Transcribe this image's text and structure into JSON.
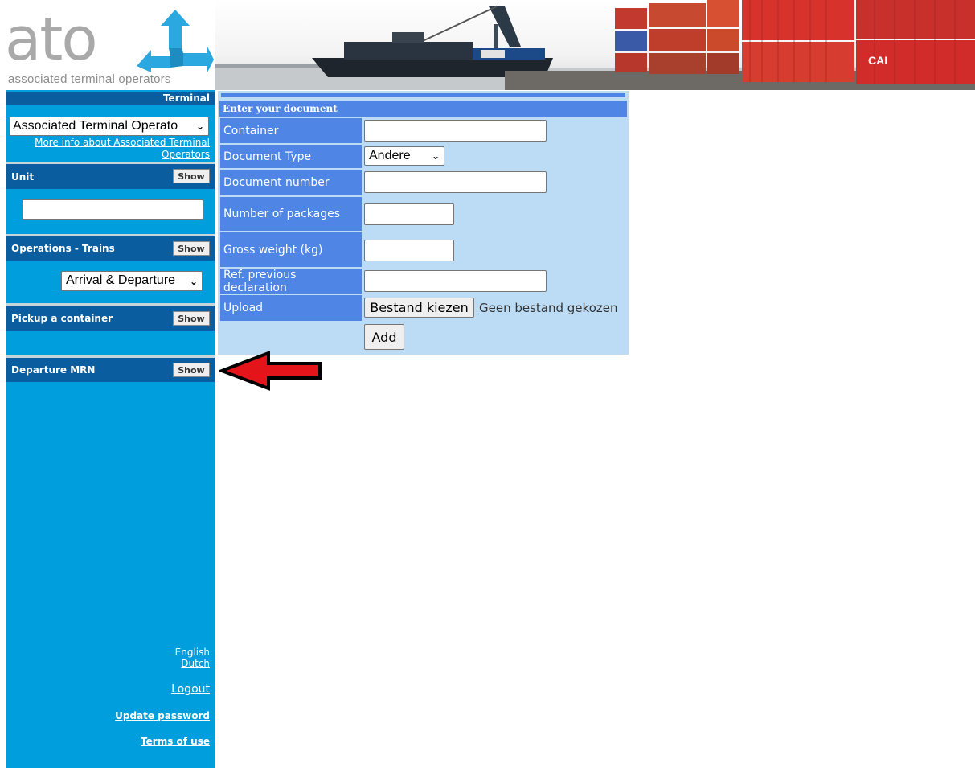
{
  "header": {
    "logo_word": "ato",
    "logo_tagline": "associated terminal operators",
    "banner_container_mark": "CAI"
  },
  "sidebar": {
    "terminal": {
      "title": "Terminal",
      "selected": "Associated Terminal Operato",
      "more_info_line1": "More info about Associated Terminal",
      "more_info_line2": "Operators"
    },
    "unit": {
      "title": "Unit",
      "show_label": "Show",
      "input_value": ""
    },
    "operations_trains": {
      "title": "Operations - Trains",
      "show_label": "Show",
      "selected": "Arrival & Departure"
    },
    "pickup": {
      "title": "Pickup a container",
      "show_label": "Show"
    },
    "departure_mrn": {
      "title": "Departure MRN",
      "show_label": "Show"
    },
    "footer": {
      "lang_current": "English",
      "lang_other": "Dutch",
      "logout": "Logout",
      "update_password": "Update password",
      "terms": "Terms of use"
    }
  },
  "form": {
    "heading": "Enter your document",
    "fields": {
      "container": {
        "label": "Container",
        "value": ""
      },
      "document_type": {
        "label": "Document Type",
        "selected": "Andere"
      },
      "document_number": {
        "label": "Document number",
        "value": ""
      },
      "packages": {
        "label": "Number of packages",
        "value": ""
      },
      "gross_weight": {
        "label": "Gross weight (kg)",
        "value": ""
      },
      "ref_previous": {
        "label": "Ref. previous declaration",
        "value": ""
      },
      "upload": {
        "label": "Upload",
        "button": "Bestand kiezen",
        "status": "Geen bestand gekozen"
      }
    },
    "add_label": "Add"
  },
  "colors": {
    "sidebar_bg": "#009edd",
    "sidebar_header": "#0a5ea0",
    "form_label_bg": "#4f86e6",
    "form_panel_bg": "#bcdcf6",
    "logo_arrow": "#2aa8df",
    "annotation_arrow": "#e4141b"
  }
}
